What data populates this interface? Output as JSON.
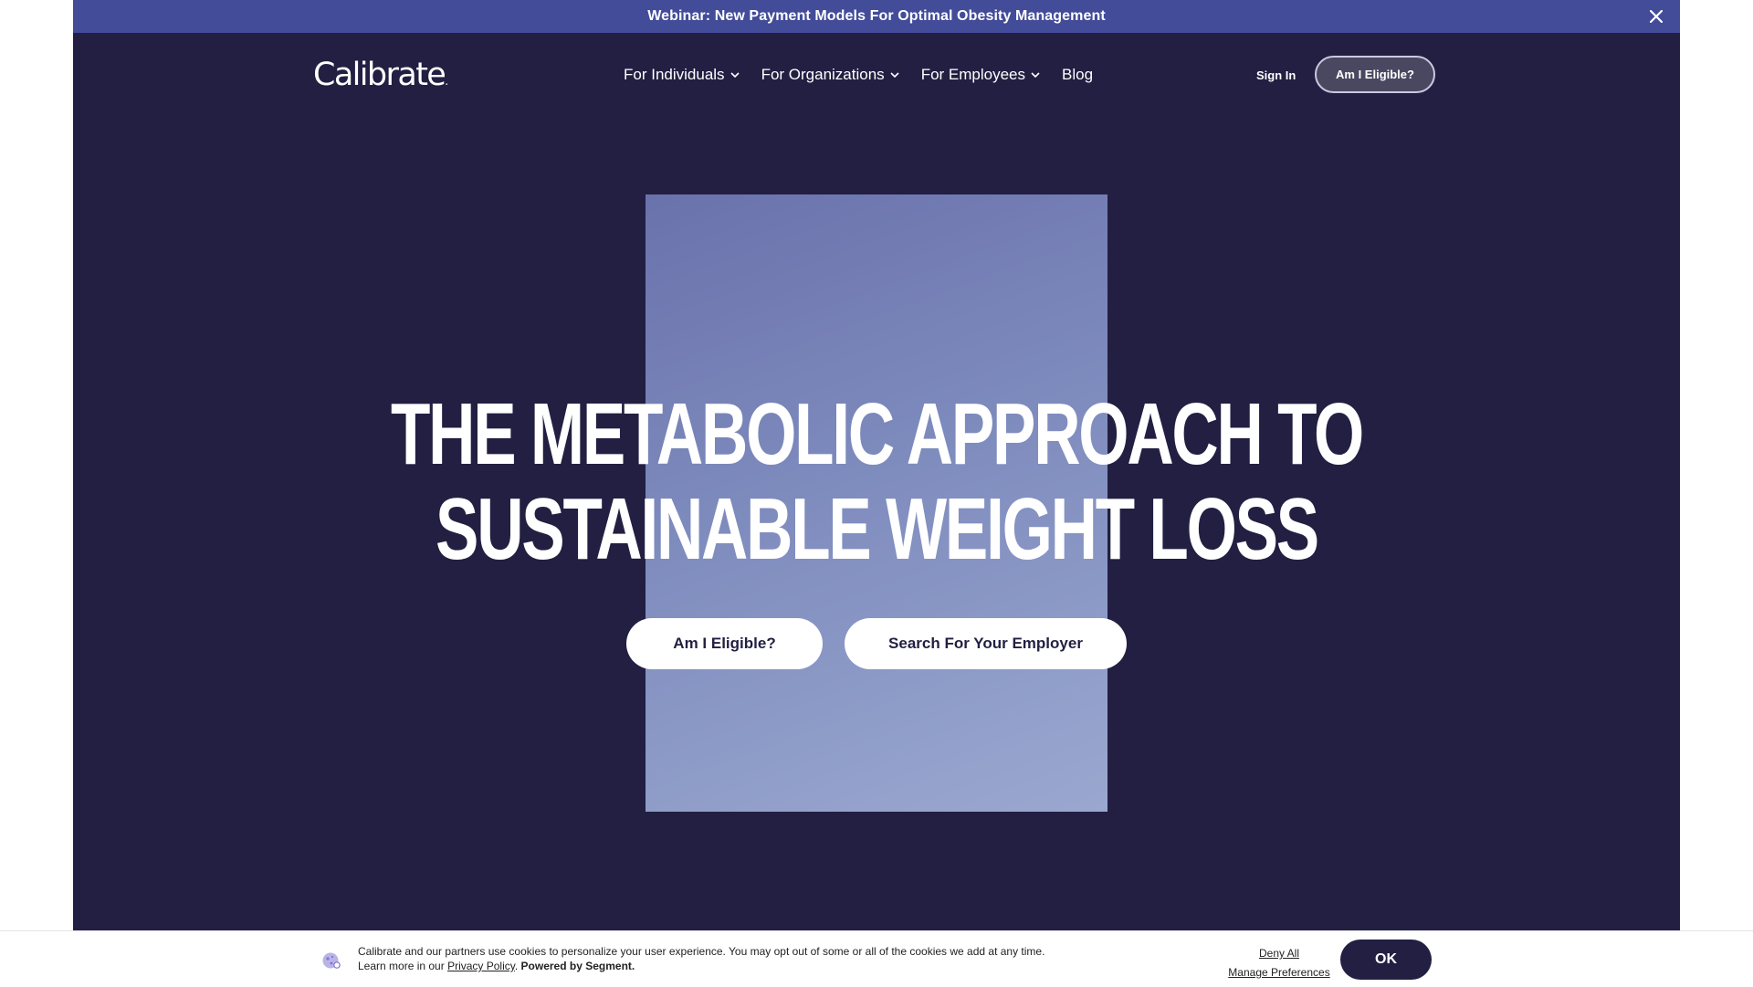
{
  "announcement": {
    "text": "Webinar: New Payment Models For Optimal Obesity Management",
    "close_icon": "close-icon"
  },
  "header": {
    "logo": "Calibrate",
    "nav": [
      {
        "label": "For Individuals",
        "icon": "chevron-down-icon"
      },
      {
        "label": "For Organizations",
        "icon": "chevron-down-icon"
      },
      {
        "label": "For Employees",
        "icon": "chevron-down-icon"
      },
      {
        "label": "Blog"
      }
    ],
    "sign_in": "Sign In",
    "cta": "Am I Eligible?"
  },
  "hero": {
    "headline_line1": "THE METABOLIC APPROACH TO",
    "headline_line2": "SUSTAINABLE WEIGHT LOSS",
    "primary_button": "Am I Eligible?",
    "secondary_button": "Search For Your Employer"
  },
  "cookie_banner": {
    "icon": "cookie-icon",
    "text_line1": "Calibrate and our partners use cookies to personalize your user experience. You may opt out of some or all of the cookies we add at any time.",
    "text_learn": "Learn more in our ",
    "privacy_link": "Privacy Policy",
    "text_after_link": ". ",
    "powered_by": "Powered by Segment.",
    "deny_all": "Deny All",
    "manage_preferences": "Manage Preferences",
    "ok": "OK"
  },
  "colors": {
    "navy": "#221f42",
    "announcement_bar": "#434c99",
    "hero_panel": "#7e8bbd"
  }
}
